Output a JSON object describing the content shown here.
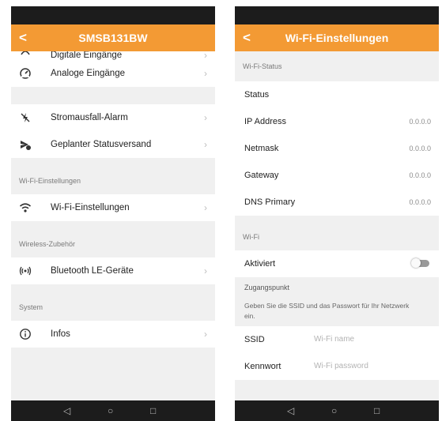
{
  "left": {
    "title": "SMSB131BW",
    "back_icon": "chevron-left-icon",
    "cut_item": "Digitale Eingänge",
    "items_top": [
      {
        "label": "Analoge Eingänge",
        "icon": "gauge-icon"
      }
    ],
    "items_power": [
      {
        "label": "Stromausfall-Alarm",
        "icon": "no-power-icon"
      },
      {
        "label": "Geplanter Statusversand",
        "icon": "scheduled-send-icon"
      }
    ],
    "sections": [
      {
        "header": "Wi-Fi-Einstellungen",
        "item": "Wi-Fi-Einstellungen",
        "icon": "wifi-icon"
      },
      {
        "header": "Wireless-Zubehör",
        "item": "Bluetooth LE-Geräte",
        "icon": "wireless-icon"
      },
      {
        "header": "System",
        "item": "Infos",
        "icon": "info-icon"
      }
    ],
    "chevron": "›"
  },
  "right": {
    "title": "Wi-Fi-Einstellungen",
    "status_header": "Wi-Fi-Status",
    "status_label": "Status",
    "rows": [
      {
        "label": "IP Address",
        "value": "0.0.0.0"
      },
      {
        "label": "Netmask",
        "value": "0.0.0.0"
      },
      {
        "label": "Gateway",
        "value": "0.0.0.0"
      },
      {
        "label": "DNS Primary",
        "value": "0.0.0.0"
      }
    ],
    "wifi_header": "Wi-Fi",
    "activated_label": "Aktiviert",
    "activated": false,
    "ap_title": "Zugangspunkt",
    "ap_desc": "Geben Sie die SSID und das Passwort für Ihr Netzwerk ein.",
    "ssid_label": "SSID",
    "ssid_placeholder": "Wi-Fi name",
    "password_label": "Kennwort",
    "password_placeholder": "Wi-Fi password"
  },
  "nav": {
    "back": "◁",
    "home": "○",
    "recents": "□"
  },
  "colors": {
    "accent": "#f39a34",
    "status_bar": "#1c1c1c",
    "background": "#f0f0f0"
  }
}
